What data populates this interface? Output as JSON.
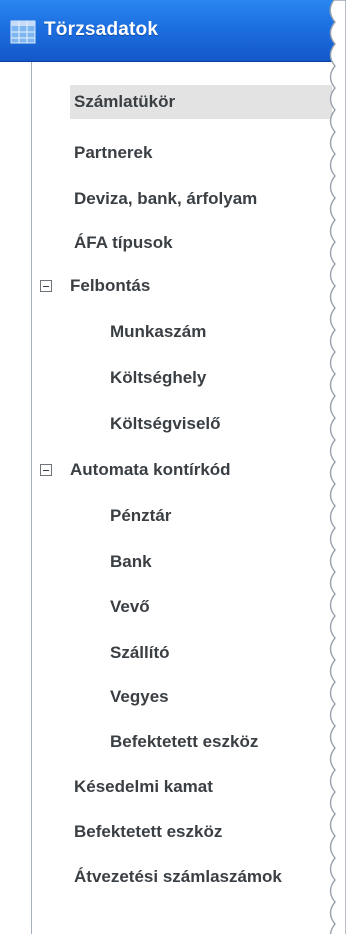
{
  "header": {
    "title": "Törzsadatok",
    "icon": "table-icon",
    "bg_color": "#1d6fe0"
  },
  "tree": {
    "items": [
      {
        "label": "Számlatükör",
        "selected": true
      },
      {
        "label": "Partnerek"
      },
      {
        "label": "Deviza, bank, árfolyam"
      },
      {
        "label": "ÁFA típusok"
      },
      {
        "label": "Felbontás",
        "expander": "collapse"
      },
      {
        "label": "Munkaszám"
      },
      {
        "label": "Költséghely"
      },
      {
        "label": "Költségviselő"
      },
      {
        "label": "Automata kontírkód",
        "expander": "collapse"
      },
      {
        "label": "Pénztár"
      },
      {
        "label": "Bank"
      },
      {
        "label": "Vevő"
      },
      {
        "label": "Szállító"
      },
      {
        "label": "Vegyes"
      },
      {
        "label": "Befektetett eszköz"
      },
      {
        "label": "Késedelmi kamat"
      },
      {
        "label": "Befektetett eszköz"
      },
      {
        "label": "Átvezetési számlaszámok"
      }
    ]
  }
}
